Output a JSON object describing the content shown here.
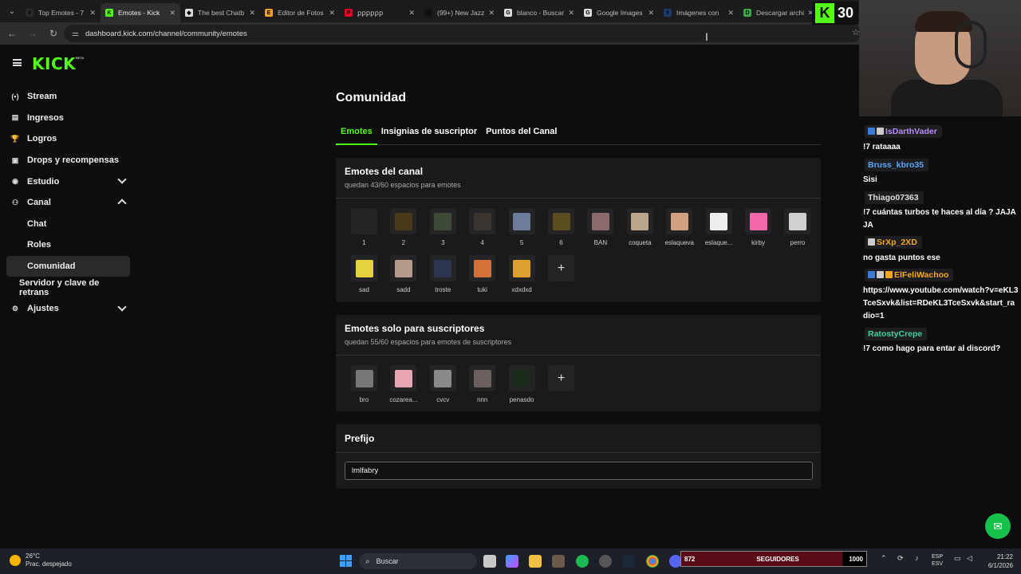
{
  "browser": {
    "tabs": [
      {
        "title": "Top Emotes - 7",
        "fav_color": "#2a2a2a",
        "fav_glyph": "#"
      },
      {
        "title": "Emotes - Kick",
        "fav_color": "#53fc18",
        "fav_glyph": "K",
        "active": true
      },
      {
        "title": "The best Chatb",
        "fav_color": "#dddddd",
        "fav_glyph": "◆"
      },
      {
        "title": "Editor de Fotos",
        "fav_color": "#f0a030",
        "fav_glyph": "E"
      },
      {
        "title": "ꝑꝑꝑꝑꝑꝑ",
        "fav_color": "#e60023",
        "fav_glyph": "P"
      },
      {
        "title": "(99+) New Jazz",
        "fav_color": "#111111",
        "fav_glyph": "♪"
      },
      {
        "title": "blanco - Buscar",
        "fav_color": "#dddddd",
        "fav_glyph": "G"
      },
      {
        "title": "Google Images",
        "fav_color": "#dddddd",
        "fav_glyph": "G"
      },
      {
        "title": "Imágenes con",
        "fav_color": "#1d3a6b",
        "fav_glyph": "t"
      },
      {
        "title": "Descargar archi",
        "fav_color": "#3aa845",
        "fav_glyph": "D"
      }
    ],
    "url": "dashboard.kick.com/channel/community/emotes"
  },
  "logo": {
    "text": "KICK",
    "beta": "BETA"
  },
  "sidebar": {
    "items": [
      {
        "label": "Stream",
        "icon": "broadcast-icon",
        "glyph": "(•)"
      },
      {
        "label": "Ingresos",
        "icon": "revenue-icon",
        "glyph": "▤"
      },
      {
        "label": "Logros",
        "icon": "trophy-icon",
        "glyph": "🏆"
      },
      {
        "label": "Drops y recompensas",
        "icon": "gift-icon",
        "glyph": "▣"
      },
      {
        "label": "Estudio",
        "icon": "studio-icon",
        "glyph": "◉",
        "expand": "down"
      },
      {
        "label": "Canal",
        "icon": "channel-icon",
        "glyph": "⚇",
        "expand": "up"
      },
      {
        "label": "Chat",
        "sub": true
      },
      {
        "label": "Roles",
        "sub": true
      },
      {
        "label": "Comunidad",
        "sub": true,
        "selected": true
      },
      {
        "label": "Servidor y clave de retrans",
        "nosi": true
      },
      {
        "label": "Ajustes",
        "icon": "settings-icon",
        "glyph": "⚙",
        "expand": "down"
      }
    ]
  },
  "page": {
    "title": "Comunidad",
    "tabs": [
      "Emotes",
      "Insignias de suscriptor",
      "Puntos del Canal"
    ]
  },
  "channel_emotes": {
    "title": "Emotes del canal",
    "subtitle": "quedan 43/60 espacios para emotes",
    "emotes": [
      {
        "name": "1",
        "color": "#242427"
      },
      {
        "name": "2",
        "color": "#4a3a1c"
      },
      {
        "name": "3",
        "color": "#3f4a36"
      },
      {
        "name": "4",
        "color": "#3a3430"
      },
      {
        "name": "5",
        "color": "#6d7d99"
      },
      {
        "name": "6",
        "color": "#5a4d1f"
      },
      {
        "name": "BAN",
        "color": "#8a6a6a"
      },
      {
        "name": "coqueta",
        "color": "#b8a58a"
      },
      {
        "name": "eslaqueva",
        "color": "#d0a080"
      },
      {
        "name": "eslaque...",
        "color": "#eeeeee"
      },
      {
        "name": "kirby",
        "color": "#f068a8"
      },
      {
        "name": "perro",
        "color": "#d0d0d0"
      },
      {
        "name": "sad",
        "color": "#e6d23a"
      },
      {
        "name": "sadd",
        "color": "#b59a8c"
      },
      {
        "name": "troste",
        "color": "#2b3550"
      },
      {
        "name": "tuki",
        "color": "#d5703a"
      },
      {
        "name": "xdxdxd",
        "color": "#e0a030"
      }
    ],
    "add": "+"
  },
  "sub_emotes": {
    "title": "Emotes solo para suscriptores",
    "subtitle": "quedan 55/60 espacios para emotes de suscriptores",
    "emotes": [
      {
        "name": "bro",
        "color": "#777777"
      },
      {
        "name": "cozarea...",
        "color": "#e8a6b5"
      },
      {
        "name": "cvcv",
        "color": "#8a8a8a"
      },
      {
        "name": "nnn",
        "color": "#6a6060"
      },
      {
        "name": "penasdo",
        "color": "#1c2a1c"
      }
    ],
    "add": "+"
  },
  "prefix": {
    "title": "Prefijo",
    "value": "lmlfabry"
  },
  "overlay": {
    "counter_letter": "K",
    "counter": "30"
  },
  "chat": [
    {
      "user": "IsDarthVader",
      "color": "#b98cf5",
      "badges": [
        "#3a7bd5",
        "#cccccc"
      ],
      "text": "!7 rataaaa"
    },
    {
      "user": "Bruss_kbro35",
      "color": "#5aa9f5",
      "badges": [],
      "text": "Sisi"
    },
    {
      "user": "Thiago07363",
      "color": "#dddddd",
      "badges": [],
      "text": "!7 cuántas turbos te haces al día ? JAJAJA"
    },
    {
      "user": "SrXp_2XD",
      "color": "#f5a623",
      "badges": [
        "#cccccc"
      ],
      "text": "no gasta puntos ese"
    },
    {
      "user": "ElFeliWachoo",
      "color": "#f5a623",
      "badges": [
        "#3a7bd5",
        "#cccccc",
        "#f5a623"
      ],
      "text": "https://www.youtube.com/watch?v=eKL3TceSxvk&list=RDeKL3TceSxvk&start_radio=1"
    },
    {
      "user": "RatostyCrepe",
      "color": "#3fd39a",
      "badges": [],
      "text": "!7 como hago para entar al discord?"
    }
  ],
  "taskbar": {
    "weather_temp": "26°C",
    "weather_desc": "Prac. despejado",
    "search": "Buscar",
    "followers_current": "872",
    "followers_label": "SEGUIDORES",
    "followers_goal": "1000",
    "followers_progress": 0.872,
    "lang1": "ESP",
    "lang2": "ESV",
    "time": "21:22",
    "date": "6/1/2026"
  }
}
